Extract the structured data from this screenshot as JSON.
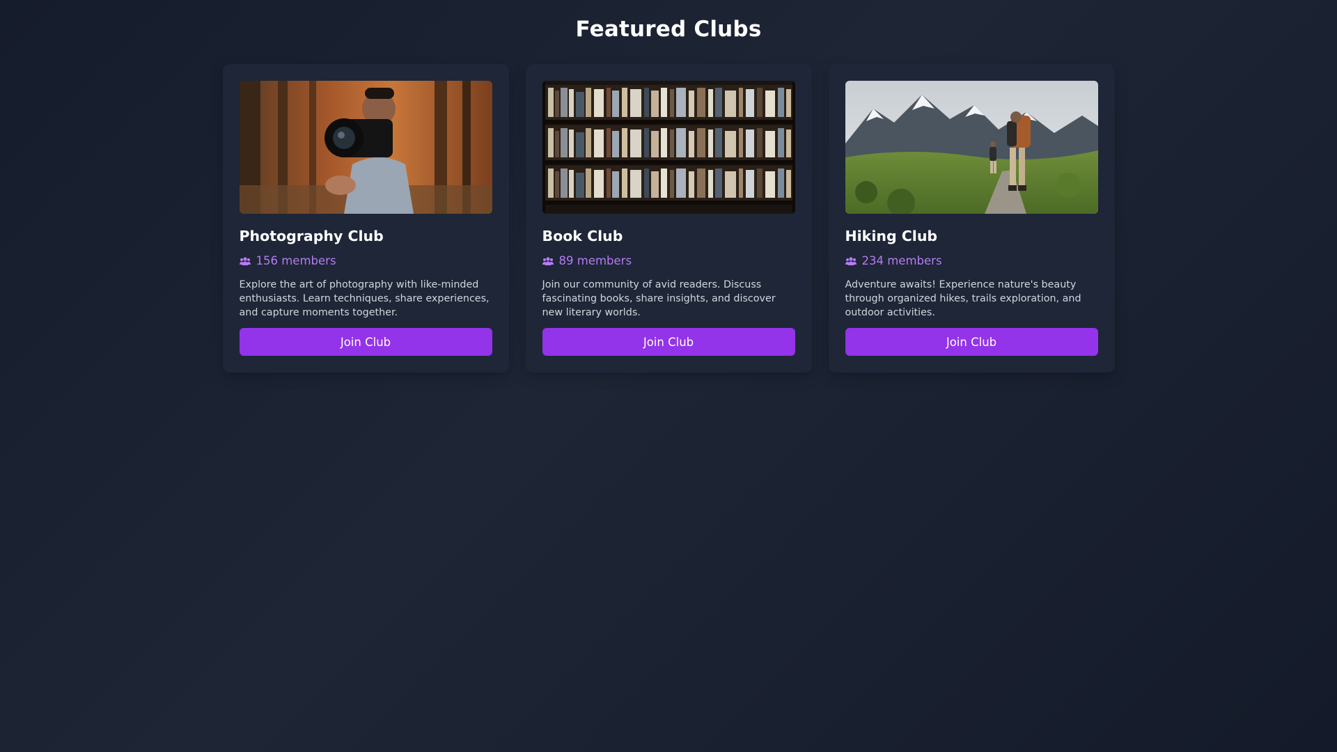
{
  "page": {
    "title": "Featured Clubs"
  },
  "colors": {
    "accent": "#9333ea",
    "members_text": "#b57cf2",
    "card_bg": "#1e2637"
  },
  "clubs": [
    {
      "name": "Photography Club",
      "members": "156 members",
      "members_icon": "users-icon",
      "description": "Explore the art of photography with like-minded enthusiasts. Learn techniques, share experiences, and capture moments together.",
      "button_label": "Join Club",
      "image": "photographer-with-camera-in-forest"
    },
    {
      "name": "Book Club",
      "members": "89 members",
      "members_icon": "users-icon",
      "description": "Join our community of avid readers. Discuss fascinating books, share insights, and discover new literary worlds.",
      "button_label": "Join Club",
      "image": "bookshelves"
    },
    {
      "name": "Hiking Club",
      "members": "234 members",
      "members_icon": "users-icon",
      "description": "Adventure awaits! Experience nature's beauty through organized hikes, trails exploration, and outdoor activities.",
      "button_label": "Join Club",
      "image": "hikers-in-mountains"
    }
  ]
}
